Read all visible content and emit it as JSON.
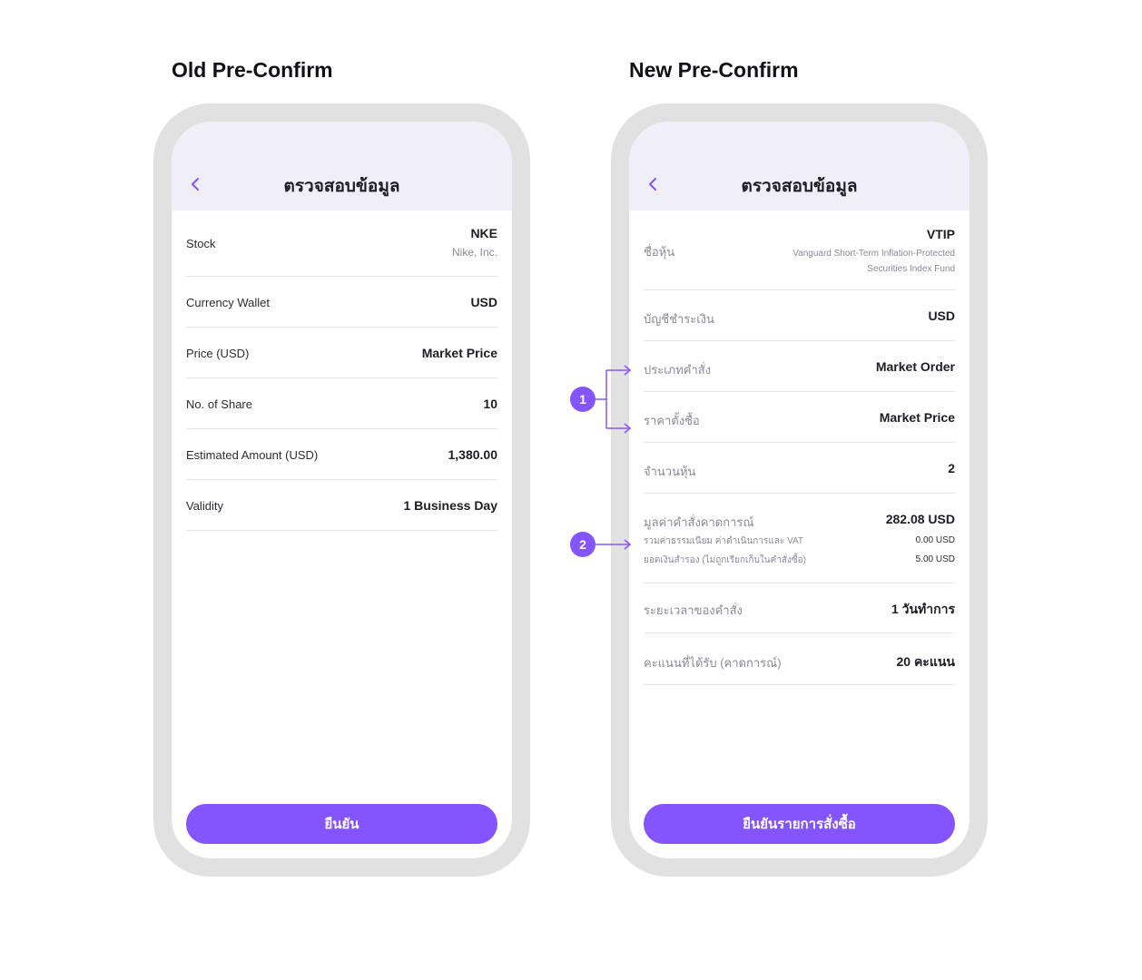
{
  "old": {
    "title": "Old Pre-Confirm",
    "header_title": "ตรวจสอบข้อมูล",
    "stock": {
      "label": "Stock",
      "symbol": "NKE",
      "name": "Nike, Inc."
    },
    "rows": [
      {
        "label": "Currency Wallet",
        "value": "USD"
      },
      {
        "label": "Price (USD)",
        "value": "Market Price"
      },
      {
        "label": "No. of Share",
        "value": "10"
      },
      {
        "label": "Estimated Amount (USD)",
        "value": "1,380.00"
      },
      {
        "label": "Validity",
        "value": "1 Business Day"
      }
    ],
    "confirm_label": "ยืนยัน"
  },
  "new": {
    "title": "New Pre-Confirm",
    "header_title": "ตรวจสอบข้อมูล",
    "stock": {
      "label": "ชื่อหุ้น",
      "symbol": "VTIP",
      "name_line1": "Vanguard Short-Term Inflation-Protected",
      "name_line2": "Securities Index Fund"
    },
    "rows": [
      {
        "label": "บัญชีชำระเงิน",
        "value": "USD"
      },
      {
        "label": "ประเภทคำสั่ง",
        "value": "Market Order"
      },
      {
        "label": "ราคาตั้งซื้อ",
        "value": "Market Price"
      },
      {
        "label": "จำนวนหุ้น",
        "value": "2"
      }
    ],
    "estimate": {
      "label": "มูลค่าคำสั่งคาดการณ์",
      "value": "282.08 USD",
      "fee_label": "รวมค่าธรรมเนียม ค่าดำเนินการและ VAT",
      "fee_value": "0.00 USD",
      "reserve_label": "ยอดเงินสำรอง (ไม่ถูกเรียกเก็บในคำสั่งซื้อ)",
      "reserve_value": "5.00 USD"
    },
    "validity": {
      "label": "ระยะเวลาของคำสั่ง",
      "value": "1 วันทำการ"
    },
    "points": {
      "label": "คะแนนที่ได้รับ (คาดการณ์)",
      "value": "20 คะแนน"
    },
    "confirm_label": "ยืนยันรายการสั่งซื้อ"
  },
  "annotations": [
    "1",
    "2"
  ],
  "colors": {
    "accent": "#8455ff",
    "header_bg": "#f0eff8",
    "frame": "#e1e1e1"
  },
  "icons": {
    "back": "chevron-left-icon"
  }
}
